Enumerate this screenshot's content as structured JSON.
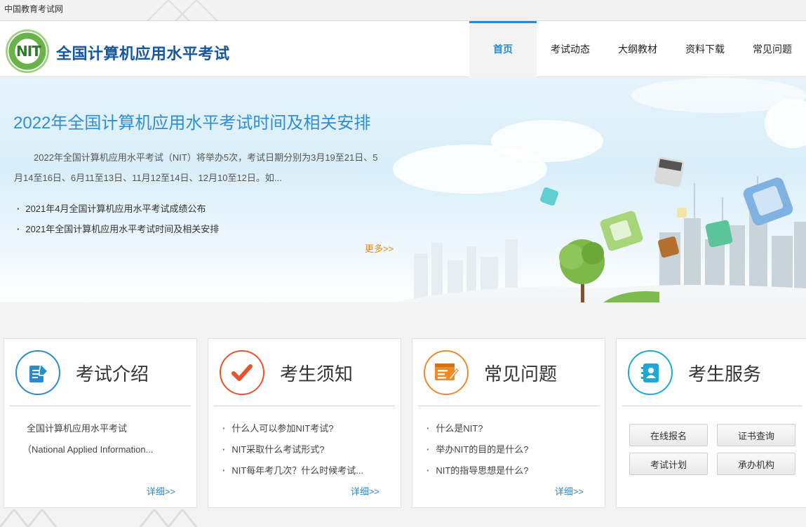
{
  "topbar": {
    "link": "中国教育考试网"
  },
  "header": {
    "logo_text": "NIT",
    "site_title": "全国计算机应用水平考试",
    "nav": [
      {
        "label": "首页",
        "active": true
      },
      {
        "label": "考试动态",
        "active": false
      },
      {
        "label": "大纲教材",
        "active": false
      },
      {
        "label": "资料下载",
        "active": false
      },
      {
        "label": "常见问题",
        "active": false
      }
    ]
  },
  "banner": {
    "title": "2022年全国计算机应用水平考试时间及相关安排",
    "description": "2022年全国计算机应用水平考试（NIT）将举办5次，考试日期分别为3月19至21日、5月14至16日、6月11至13日、11月12至14日、12月10至12日。如...",
    "news": [
      "2021年4月全国计算机应用水平考试成绩公布",
      "2021年全国计算机应用水平考试时间及相关安排"
    ],
    "more": "更多>>"
  },
  "cards": {
    "intro": {
      "title": "考试介绍",
      "icon": "document-pen-icon",
      "color": "#2a8bd1",
      "lines": [
        "全国计算机应用水平考试",
        "（National Applied Information..."
      ],
      "more": "详细>>"
    },
    "notice": {
      "title": "考生须知",
      "icon": "checkmark-icon",
      "color": "#e8542c",
      "items": [
        "什么人可以参加NIT考试?",
        "NIT采取什么考试形式?",
        "NIT每年考几次？什么时候考试..."
      ],
      "more": "详细>>"
    },
    "faq": {
      "title": "常见问题",
      "icon": "form-edit-icon",
      "color": "#ef8a2a",
      "items": [
        "什么是NIT?",
        "举办NIT的目的是什么?",
        "NIT的指导思想是什么?"
      ],
      "more": "详细>>"
    },
    "service": {
      "title": "考生服务",
      "icon": "contact-book-icon",
      "color": "#1fa8d6",
      "buttons": [
        "在线报名",
        "证书查询",
        "考试计划",
        "承办机构"
      ]
    }
  }
}
